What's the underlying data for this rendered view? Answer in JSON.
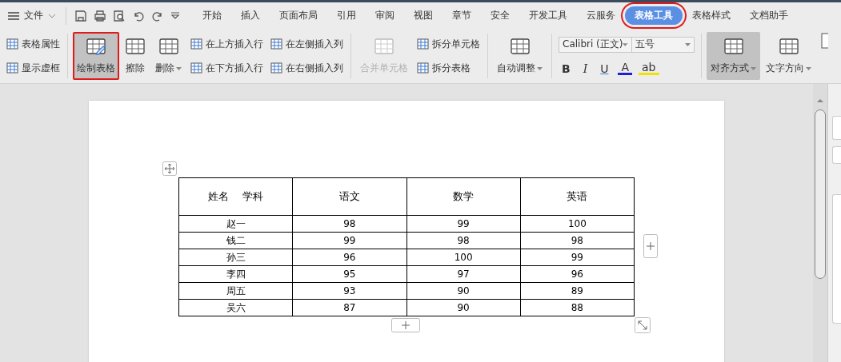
{
  "menu": {
    "label": "文件"
  },
  "tabs": [
    {
      "label": "开始",
      "selected": false,
      "highlighted": false
    },
    {
      "label": "插入",
      "selected": false,
      "highlighted": false
    },
    {
      "label": "页面布局",
      "selected": false,
      "highlighted": false
    },
    {
      "label": "引用",
      "selected": false,
      "highlighted": false
    },
    {
      "label": "审阅",
      "selected": false,
      "highlighted": false
    },
    {
      "label": "视图",
      "selected": false,
      "highlighted": false
    },
    {
      "label": "章节",
      "selected": false,
      "highlighted": false
    },
    {
      "label": "安全",
      "selected": false,
      "highlighted": false
    },
    {
      "label": "开发工具",
      "selected": false,
      "highlighted": false
    },
    {
      "label": "云服务",
      "selected": false,
      "highlighted": false
    },
    {
      "label": "表格工具",
      "selected": true,
      "highlighted": true
    },
    {
      "label": "表格样式",
      "selected": false,
      "highlighted": false
    },
    {
      "label": "文档助手",
      "selected": false,
      "highlighted": false
    }
  ],
  "ribbon": {
    "groups": [
      {
        "items": [
          {
            "kind": "stack",
            "buttons": [
              {
                "label": "表格属性"
              },
              {
                "label": "显示虚框"
              }
            ]
          }
        ]
      },
      {
        "items": [
          {
            "kind": "big",
            "label": "绘制表格",
            "selected": true,
            "highlighted": true,
            "dropdown": false,
            "disabled": false
          },
          {
            "kind": "big",
            "label": "擦除",
            "selected": false,
            "highlighted": false,
            "dropdown": false,
            "disabled": false
          },
          {
            "kind": "big",
            "label": "删除",
            "selected": false,
            "highlighted": false,
            "dropdown": true,
            "disabled": false
          },
          {
            "kind": "stack",
            "buttons": [
              {
                "label": "在上方插入行"
              },
              {
                "label": "在下方插入行"
              }
            ]
          },
          {
            "kind": "stack",
            "buttons": [
              {
                "label": "在左侧插入列"
              },
              {
                "label": "在右侧插入列"
              }
            ]
          }
        ]
      },
      {
        "items": [
          {
            "kind": "big",
            "label": "合并单元格",
            "selected": false,
            "highlighted": false,
            "dropdown": false,
            "disabled": true
          },
          {
            "kind": "stack",
            "buttons": [
              {
                "label": "拆分单元格"
              },
              {
                "label": "拆分表格"
              }
            ]
          }
        ]
      },
      {
        "items": [
          {
            "kind": "big",
            "label": "自动调整",
            "selected": false,
            "highlighted": false,
            "dropdown": true,
            "disabled": false
          }
        ]
      },
      {
        "items": [
          {
            "kind": "font",
            "font": "Calibri (正文)",
            "size": "五号",
            "format": [
              "B",
              "I",
              "U",
              "A",
              "ab"
            ]
          }
        ]
      },
      {
        "items": [
          {
            "kind": "big",
            "label": "对齐方式",
            "selected": true,
            "highlighted": false,
            "dropdown": true,
            "disabled": false
          },
          {
            "kind": "big",
            "label": "文字方向",
            "selected": false,
            "highlighted": false,
            "dropdown": true,
            "disabled": false
          }
        ]
      }
    ]
  },
  "table": {
    "header": [
      "姓名　 学科",
      "语文",
      "数学",
      "英语"
    ],
    "rows": [
      [
        "赵一",
        "98",
        "99",
        "100"
      ],
      [
        "钱二",
        "99",
        "98",
        "98"
      ],
      [
        "孙三",
        "96",
        "100",
        "99"
      ],
      [
        "李四",
        "95",
        "97",
        "96"
      ],
      [
        "周五",
        "93",
        "90",
        "89"
      ],
      [
        "吴六",
        "87",
        "90",
        "88"
      ]
    ]
  }
}
